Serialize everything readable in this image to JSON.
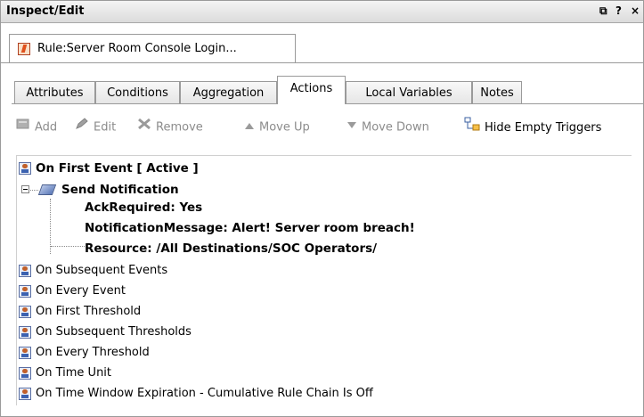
{
  "panel": {
    "title": "Inspect/Edit",
    "controls": [
      "⧉",
      "?",
      "×"
    ]
  },
  "doc_tab": {
    "label": "Rule:Server Room Console Login..."
  },
  "tabs": [
    {
      "label": "Attributes"
    },
    {
      "label": "Conditions"
    },
    {
      "label": "Aggregation"
    },
    {
      "label": "Actions",
      "active": true
    },
    {
      "label": "Local Variables"
    },
    {
      "label": "Notes"
    }
  ],
  "toolbar": {
    "add": "Add",
    "edit": "Edit",
    "remove": "Remove",
    "move_up": "Move Up",
    "move_down": "Move Down",
    "hide_empty": "Hide Empty Triggers"
  },
  "tree": {
    "first_event": "On First Event [ Active ]",
    "send_notification": "Send Notification",
    "ack": "AckRequired: Yes",
    "message": "NotificationMessage: Alert! Server room breach!",
    "resource": "Resource: /All Destinations/SOC Operators/",
    "triggers": [
      "On Subsequent Events",
      "On Every Event",
      "On First Threshold",
      "On Subsequent Thresholds",
      "On Every Threshold",
      "On Time Unit",
      "On Time Window Expiration - Cumulative Rule Chain Is Off"
    ]
  }
}
